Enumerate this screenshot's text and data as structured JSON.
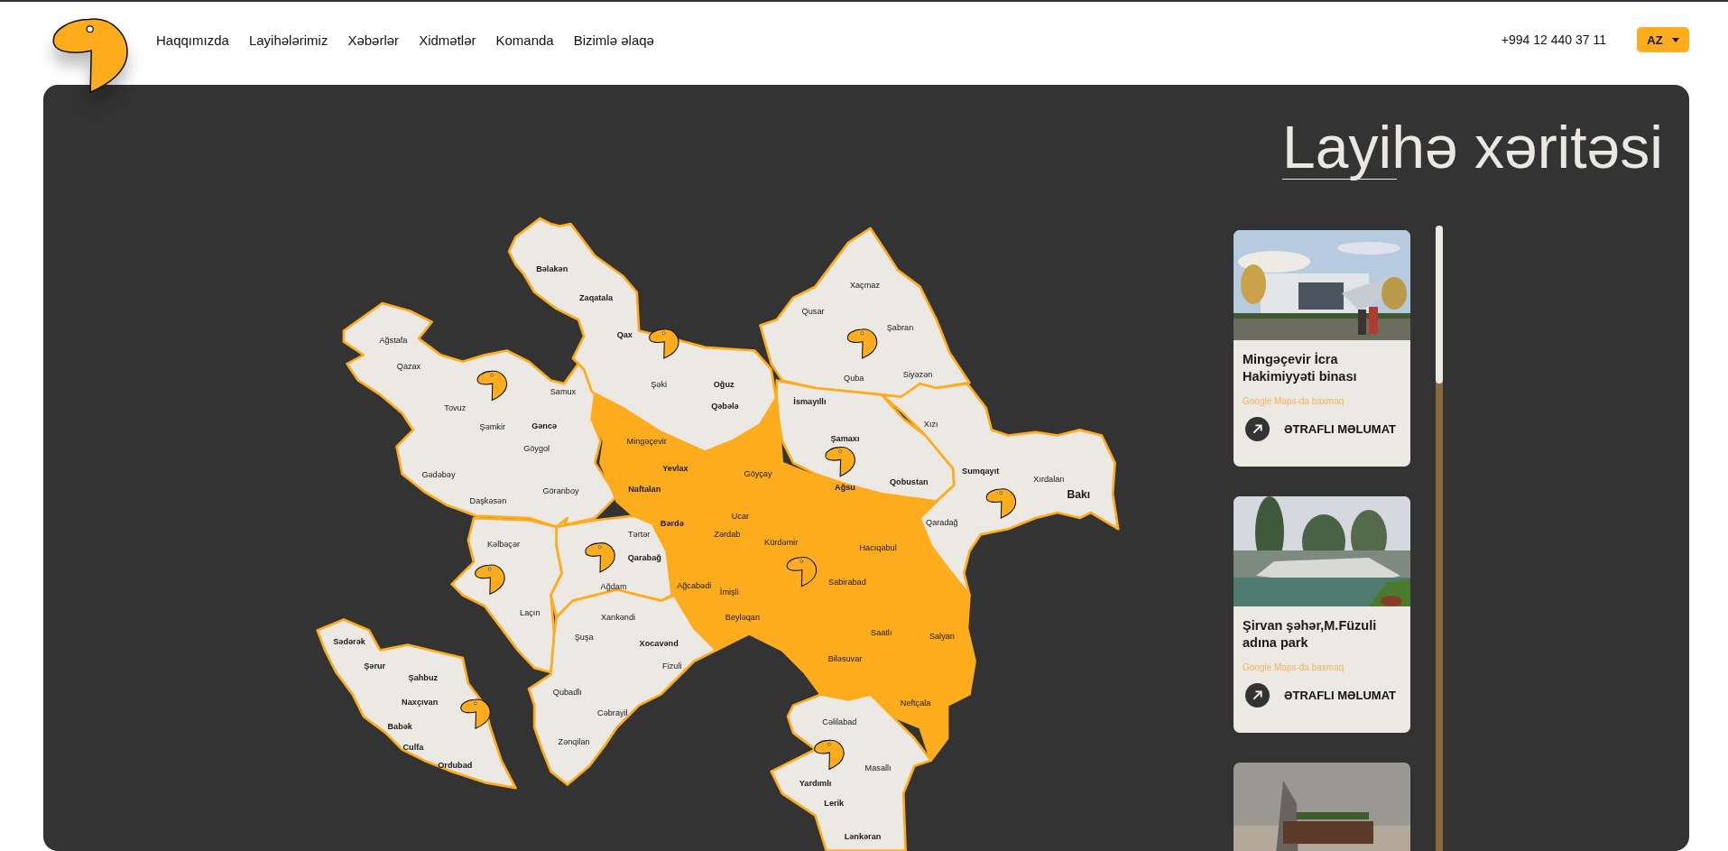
{
  "header": {
    "nav": [
      {
        "label": "Haqqımızda"
      },
      {
        "label": "Layihələrimiz"
      },
      {
        "label": "Xəbərlər"
      },
      {
        "label": "Xidmətlər"
      },
      {
        "label": "Komanda"
      },
      {
        "label": "Bizimlə əlaqə"
      }
    ],
    "phone": "+994 12 440 37 11",
    "language": "AZ"
  },
  "map_section": {
    "title": "Layihə xəritəsi",
    "regions": [
      {
        "highlighted": false,
        "labels": [
          {
            "text": "Ağstafa",
            "bold": false
          },
          {
            "text": "Qazax",
            "bold": false
          },
          {
            "text": "Samux",
            "bold": false
          },
          {
            "text": "Tovuz",
            "bold": false
          },
          {
            "text": "Şəmkir",
            "bold": false
          },
          {
            "text": "Gəncə",
            "bold": true
          },
          {
            "text": "Göygol",
            "bold": false
          },
          {
            "text": "Gədəbəy",
            "bold": false
          },
          {
            "text": "Daşkəsən",
            "bold": false
          },
          {
            "text": "Göranboy",
            "bold": false
          }
        ]
      },
      {
        "highlighted": false,
        "labels": [
          {
            "text": "Bəlakən",
            "bold": true
          },
          {
            "text": "Zaqatala",
            "bold": true
          },
          {
            "text": "Qax",
            "bold": true
          },
          {
            "text": "Şəki",
            "bold": false
          },
          {
            "text": "Oğuz",
            "bold": true
          },
          {
            "text": "Qəbələ",
            "bold": true
          }
        ]
      },
      {
        "highlighted": false,
        "labels": [
          {
            "text": "Xaçmaz",
            "bold": false
          },
          {
            "text": "Qusar",
            "bold": false
          },
          {
            "text": "Şabran",
            "bold": false
          },
          {
            "text": "Quba",
            "bold": false
          },
          {
            "text": "Siyəzən",
            "bold": false
          }
        ]
      },
      {
        "highlighted": false,
        "labels": [
          {
            "text": "İsmayıllı",
            "bold": true
          },
          {
            "text": "Şamaxı",
            "bold": true
          },
          {
            "text": "Ağsu",
            "bold": true
          },
          {
            "text": "Qobustan",
            "bold": true
          }
        ]
      },
      {
        "highlighted": false,
        "labels": [
          {
            "text": "Xızı",
            "bold": false
          },
          {
            "text": "Sumqayıt",
            "bold": true
          },
          {
            "text": "Xırdalan",
            "bold": false
          },
          {
            "text": "Bakı",
            "bold": true
          },
          {
            "text": "Qaradağ",
            "bold": false
          }
        ]
      },
      {
        "highlighted": true,
        "labels": [
          {
            "text": "Mingəçevir",
            "bold": false
          },
          {
            "text": "Yevlax",
            "bold": true
          },
          {
            "text": "Göyçay",
            "bold": false
          },
          {
            "text": "Naftalan",
            "bold": true
          },
          {
            "text": "Bərdə",
            "bold": true
          },
          {
            "text": "Ucar",
            "bold": false
          },
          {
            "text": "Zərdab",
            "bold": false
          },
          {
            "text": "Kürdəmir",
            "bold": false
          },
          {
            "text": "Hacıqabul",
            "bold": false
          },
          {
            "text": "Ağcabədi",
            "bold": false
          },
          {
            "text": "İmişli",
            "bold": false
          },
          {
            "text": "Sabirabad",
            "bold": false
          },
          {
            "text": "Beyləqan",
            "bold": false
          },
          {
            "text": "Saatlı",
            "bold": false
          },
          {
            "text": "Salyan",
            "bold": false
          },
          {
            "text": "Biləsuvar",
            "bold": false
          },
          {
            "text": "Neftçala",
            "bold": false
          }
        ]
      },
      {
        "highlighted": false,
        "labels": [
          {
            "text": "Kəlbəçər",
            "bold": false
          },
          {
            "text": "Laçın",
            "bold": false
          }
        ]
      },
      {
        "highlighted": false,
        "labels": [
          {
            "text": "Tərtər",
            "bold": false
          },
          {
            "text": "Qarabağ",
            "bold": true
          },
          {
            "text": "Ağdam",
            "bold": false
          }
        ]
      },
      {
        "highlighted": false,
        "labels": [
          {
            "text": "Xankəndi",
            "bold": false
          },
          {
            "text": "Şuşa",
            "bold": false
          },
          {
            "text": "Xocavənd",
            "bold": true
          },
          {
            "text": "Fizuli",
            "bold": false
          },
          {
            "text": "Qubadlı",
            "bold": false
          },
          {
            "text": "Cəbrayil",
            "bold": false
          },
          {
            "text": "Zənqilan",
            "bold": false
          }
        ]
      },
      {
        "highlighted": false,
        "labels": [
          {
            "text": "Cəlilabad",
            "bold": false
          },
          {
            "text": "Masallı",
            "bold": false
          },
          {
            "text": "Yardımlı",
            "bold": true
          },
          {
            "text": "Lerik",
            "bold": true
          },
          {
            "text": "Lənkəran",
            "bold": true
          }
        ]
      },
      {
        "highlighted": false,
        "labels": [
          {
            "text": "Sədərək",
            "bold": true
          },
          {
            "text": "Şərur",
            "bold": true
          },
          {
            "text": "Şahbuz",
            "bold": true
          },
          {
            "text": "Naxçıvan",
            "bold": true
          },
          {
            "text": "Babək",
            "bold": true
          },
          {
            "text": "Culfa",
            "bold": true
          },
          {
            "text": "Ordubad",
            "bold": true
          }
        ]
      }
    ]
  },
  "projects": [
    {
      "kind": "full",
      "title": "Mingəçevir İcra Hakimiyyəti binası",
      "maps_link": "Google Maps-da baxmaq",
      "more": "ƏTRAFLI MƏLUMAT"
    },
    {
      "kind": "full",
      "title": "Şirvan şəhər,M.Füzuli adına park",
      "maps_link": "Google Maps-da baxmaq",
      "more": "ƏTRAFLI MƏLUMAT"
    },
    {
      "kind": "cut"
    }
  ]
}
